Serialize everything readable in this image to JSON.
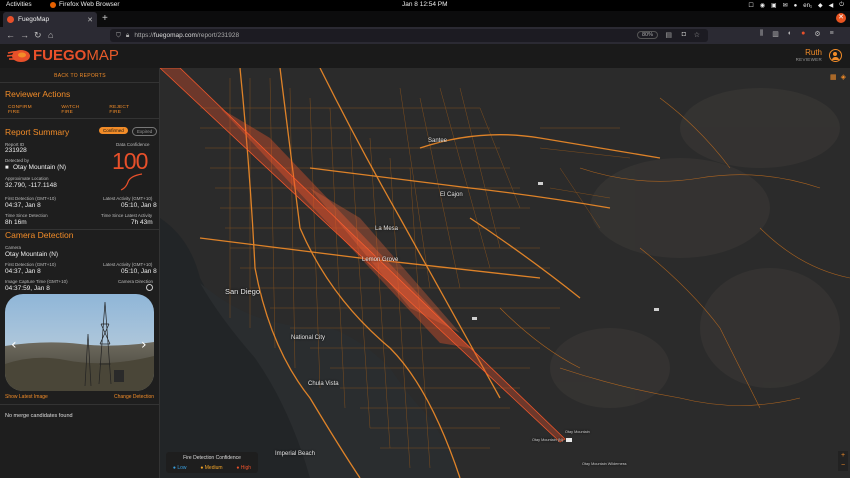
{
  "os": {
    "activities": "Activities",
    "app_name": "Firefox Web Browser",
    "clock": "Jan 8  12:54 PM",
    "lang": "en₁"
  },
  "browser": {
    "tab_title": "FuegoMap",
    "url_protocol": "https://",
    "url_host": "fuegomap.com",
    "url_path": "/report/231928",
    "zoom": "80%"
  },
  "header": {
    "logo_a": "FUEGO",
    "logo_b": "MAP",
    "user_name": "Ruth",
    "user_role": "REVIEWER"
  },
  "sidebar": {
    "back": "BACK TO REPORTS",
    "reviewer_title": "Reviewer Actions",
    "actions": [
      "CONFIRM FIRE",
      "WATCH FIRE",
      "REJECT FIRE"
    ],
    "summary_title": "Report Summary",
    "badge_confirmed": "Confirmed",
    "badge_expired": "Expired",
    "report_id_label": "Report ID",
    "report_id": "231928",
    "confidence_label": "Data Confidence",
    "confidence": "100",
    "detected_by_label": "Detected by",
    "detected_by": "Otay Mountain (N)",
    "approx_loc_label": "Approximate Location",
    "approx_loc": "32.790, -117.1148",
    "first_det_label": "First Detection (GMT+10)",
    "first_det": "04:37, Jan 8",
    "latest_act_label": "Latest Activity (GMT+10)",
    "latest_act": "05:10, Jan 8",
    "since_det_label": "Time Since Detection",
    "since_det": "8h 16m",
    "since_act_label": "Time Since Latest Activity",
    "since_act": "7h 43m",
    "camera_title": "Camera Detection",
    "camera_label": "Camera",
    "camera": "Otay Mountain (N)",
    "cam_first_label": "First Detection (GMT+10)",
    "cam_first": "04:37, Jan 8",
    "cam_latest_label": "Latest Activity (GMT+10)",
    "cam_latest": "05:10, Jan 8",
    "capture_label": "Image Capture Time (GMT+10)",
    "capture": "04:37:59, Jan 8",
    "cam_dir_label": "Camera Direction",
    "show_latest": "Show Latest Image",
    "change_det": "Change Detection",
    "no_merge": "No merge candidates found"
  },
  "map": {
    "labels_big": [
      "San Diego",
      "El Cajon",
      "La Mesa",
      "National City",
      "Chula Vista",
      "Imperial Beach",
      "Santee",
      "Lemon Grove"
    ],
    "labels_small": [
      "Otay Mountain (N)",
      "Otay Mountain",
      "Otay Mountain Wilderness"
    ],
    "legend_title": "Fire Detection Confidence",
    "legend_low": "Low",
    "legend_med": "Medium",
    "legend_high": "High",
    "colors": {
      "low": "#3aa0e0",
      "medium": "#f2a428",
      "high": "#e8502a",
      "accent": "#f28c28"
    }
  }
}
